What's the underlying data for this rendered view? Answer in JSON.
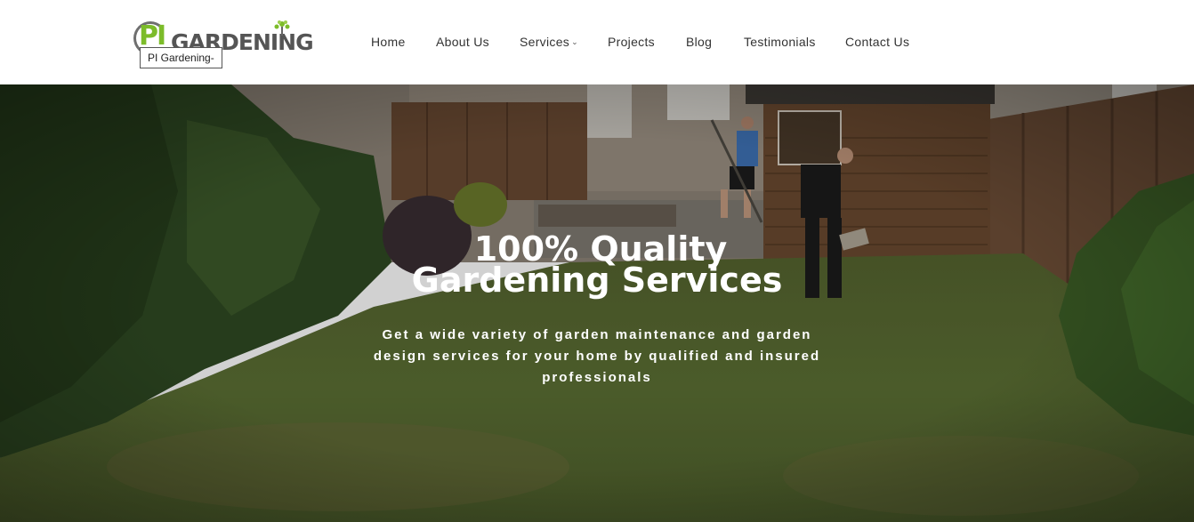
{
  "header": {
    "logo": {
      "mark": "PI",
      "word": "GARDENING",
      "tooltip": "PI Gardening-",
      "icon": "leaves-icon"
    },
    "nav": [
      {
        "label": "Home"
      },
      {
        "label": "About Us"
      },
      {
        "label": "Services",
        "has_dropdown": true
      },
      {
        "label": "Projects"
      },
      {
        "label": "Blog"
      },
      {
        "label": "Testimonials"
      },
      {
        "label": "Contact Us"
      }
    ]
  },
  "hero": {
    "title_line1": "100% Quality",
    "title_line2": "Gardening Services",
    "subtitle": "Get a wide variety of garden maintenance and garden design services for your home by qualified and insured professionals",
    "background": "garden photo"
  },
  "colors": {
    "brand_green": "#7cbc2a",
    "logo_grey": "#555555",
    "nav_text": "#333333"
  }
}
